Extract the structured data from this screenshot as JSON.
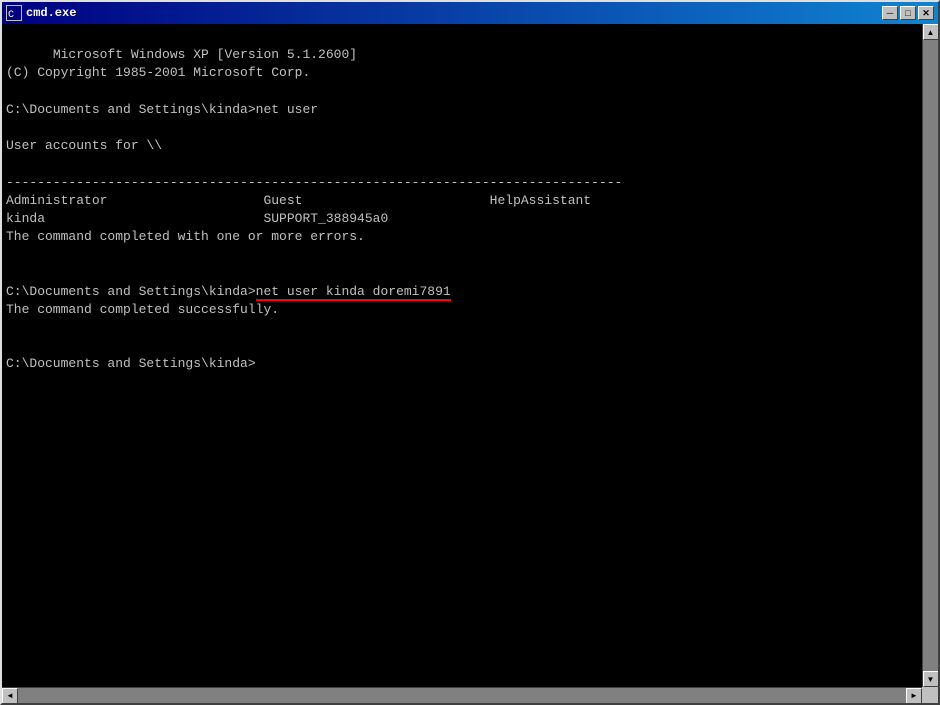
{
  "window": {
    "title": "cmd.exe",
    "titlebar_icon": "▪",
    "btn_minimize": "─",
    "btn_maximize": "□",
    "btn_close": "✕"
  },
  "terminal": {
    "line1": "Microsoft Windows XP [Version 5.1.2600]",
    "line2": "(C) Copyright 1985-2001 Microsoft Corp.",
    "line3": "",
    "line4": "C:\\Documents and Settings\\kinda>net user",
    "line5": "",
    "line6": "User accounts for \\\\",
    "line7": "",
    "line8": "-------------------------------------------------------------------------------",
    "line9_col1": "Administrator",
    "line9_col2": "Guest",
    "line9_col3": "HelpAssistant",
    "line10_col1": "kinda",
    "line10_col2": "SUPPORT_388945a0",
    "line11": "The command completed with one or more errors.",
    "line12": "",
    "line13": "",
    "line14": "C:\\Documents and Settings\\kinda>net user kinda doremi7891",
    "line15": "The command completed successfully.",
    "line16": "",
    "line17": "",
    "line18": "C:\\Documents and Settings\\kinda>",
    "underlined_text": "net user kinda doremi7891"
  }
}
